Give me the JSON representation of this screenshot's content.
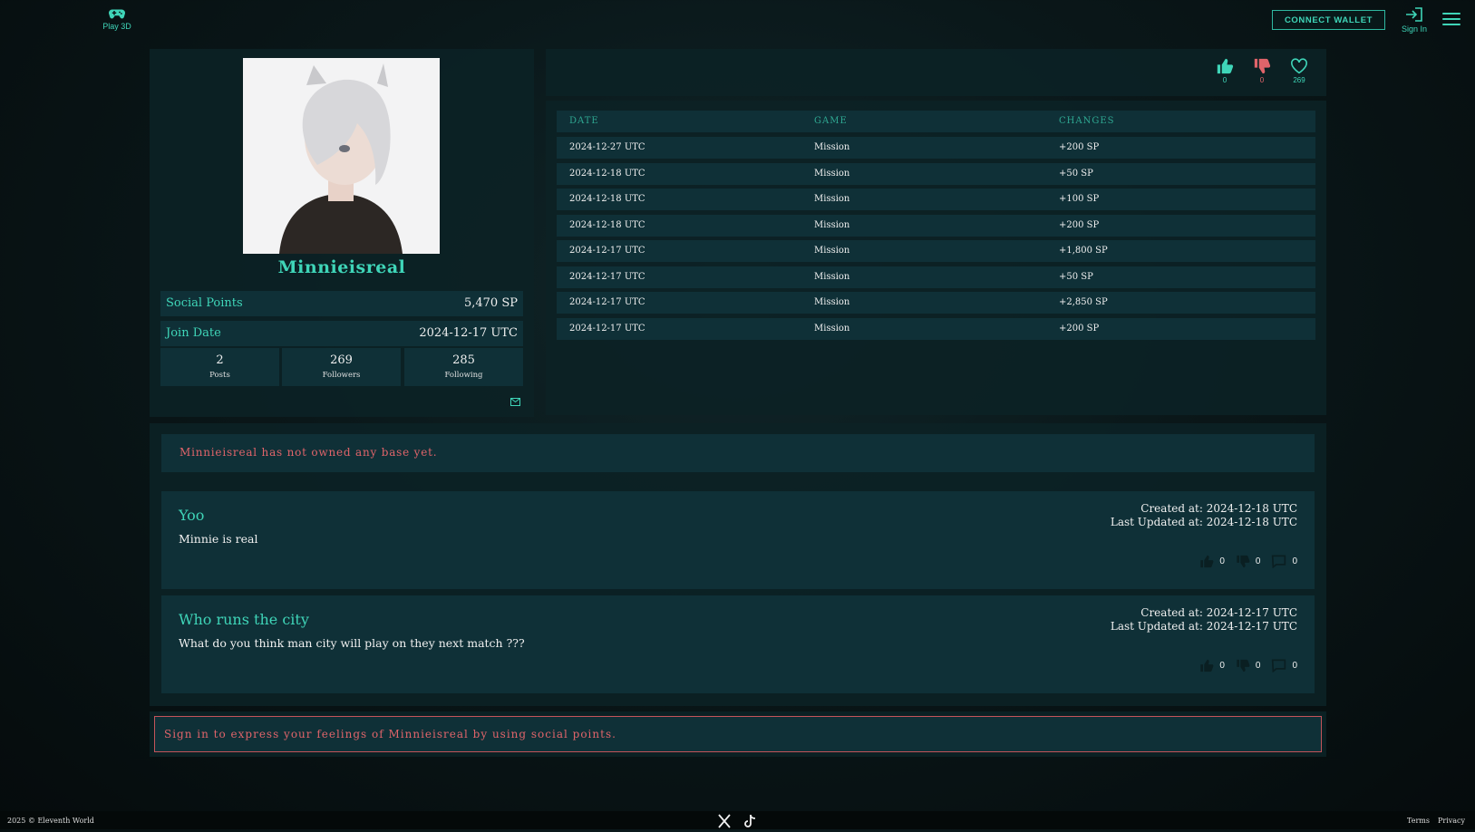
{
  "header": {
    "play_label": "Play 3D",
    "connect_wallet": "CONNECT WALLET",
    "signin_label": "Sign In"
  },
  "profile": {
    "username": "Minnieisreal",
    "social_points_label": "Social Points",
    "social_points_value": "5,470 SP",
    "join_date_label": "Join Date",
    "join_date_value": "2024-12-17 UTC",
    "stats": [
      {
        "value": "2",
        "label": "Posts"
      },
      {
        "value": "269",
        "label": "Followers"
      },
      {
        "value": "285",
        "label": "Following"
      }
    ]
  },
  "reactions": {
    "likes": "0",
    "dislikes": "0",
    "hearts": "269",
    "colors": {
      "like": "#3fd5b8",
      "dislike": "#e0646a",
      "heart": "#3fd5b8"
    }
  },
  "history": {
    "headers": [
      "DATE",
      "GAME",
      "CHANGES"
    ],
    "rows": [
      [
        "2024-12-27 UTC",
        "Mission",
        "+200 SP"
      ],
      [
        "2024-12-18 UTC",
        "Mission",
        "+50 SP"
      ],
      [
        "2024-12-18 UTC",
        "Mission",
        "+100 SP"
      ],
      [
        "2024-12-18 UTC",
        "Mission",
        "+200 SP"
      ],
      [
        "2024-12-17 UTC",
        "Mission",
        "+1,800 SP"
      ],
      [
        "2024-12-17 UTC",
        "Mission",
        "+50 SP"
      ],
      [
        "2024-12-17 UTC",
        "Mission",
        "+2,850 SP"
      ],
      [
        "2024-12-17 UTC",
        "Mission",
        "+200 SP"
      ]
    ]
  },
  "base_notice": "Minnieisreal has not owned any base yet.",
  "posts": [
    {
      "title": "Yoo",
      "body": "Minnie is real",
      "created": "Created at: 2024-12-18 UTC",
      "updated": "Last Updated at: 2024-12-18 UTC",
      "likes": "0",
      "dislikes": "0",
      "comments": "0"
    },
    {
      "title": "Who runs the city",
      "body": "What do you think man city will play on they next match ???",
      "created": "Created at: 2024-12-17 UTC",
      "updated": "Last Updated at: 2024-12-17 UTC",
      "likes": "0",
      "dislikes": "0",
      "comments": "0"
    }
  ],
  "sign_in_prompt": "Sign in to express your feelings of Minnieisreal by using social points.",
  "footer": {
    "copyright": "2025 © Eleventh World",
    "terms": "Terms",
    "privacy": "Privacy"
  },
  "theme": {
    "accent": "#3fd5b8",
    "warning": "#e0646a",
    "panel": "#0f3037"
  }
}
